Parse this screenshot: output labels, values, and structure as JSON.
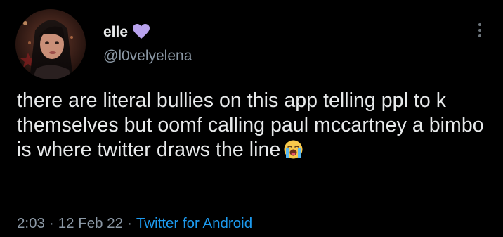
{
  "author": {
    "display_name": "elle",
    "handle": "@l0velyelena",
    "badge_icon": "purple-heart-icon",
    "badge_color": "#b9a3ee"
  },
  "tweet": {
    "text": "there are literal bullies on this app telling ppl to k themselves but oomf calling paul mccartney a bimbo is where twitter draws the line",
    "trailing_emoji": "loudly-crying-face-emoji"
  },
  "meta": {
    "time": "2:03",
    "separator": "·",
    "date": "12 Feb 22",
    "source": "Twitter for Android"
  },
  "colors": {
    "background": "#000000",
    "primary_text": "#e7e9ea",
    "secondary_text": "#8b98a5",
    "link": "#1d9bf0"
  }
}
